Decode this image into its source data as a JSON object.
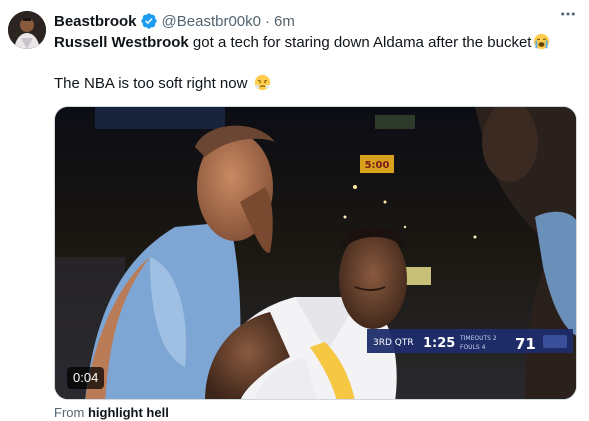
{
  "author": {
    "display_name": "Beastbrook",
    "handle": "@Beastbr00k0",
    "separator": "·",
    "timestamp": "6m",
    "verified": true
  },
  "menu": {
    "more_icon": "more-horizontal-icon"
  },
  "tweet": {
    "mention": "Russell Westbrook",
    "line1_rest": " got a tech for staring down Aldama after the bucket",
    "line1_emoji": "loudly-crying-face",
    "line2": "The NBA is too soft right now",
    "line2_emoji": "face-with-steam-from-nose"
  },
  "media": {
    "type": "video",
    "duration": "0:04",
    "scorebug": {
      "quarter": "3RD QTR",
      "clock": "1:25",
      "timeouts": "TIMEOUTS 2",
      "fouls": "FOULS 4",
      "score": "71",
      "arena_sign": "5:00"
    }
  },
  "source": {
    "prefix": "From ",
    "name": "highlight hell"
  },
  "colors": {
    "text": "#0f1419",
    "muted": "#536471",
    "verified": "#1d9bf0",
    "border": "#cfd9de"
  }
}
